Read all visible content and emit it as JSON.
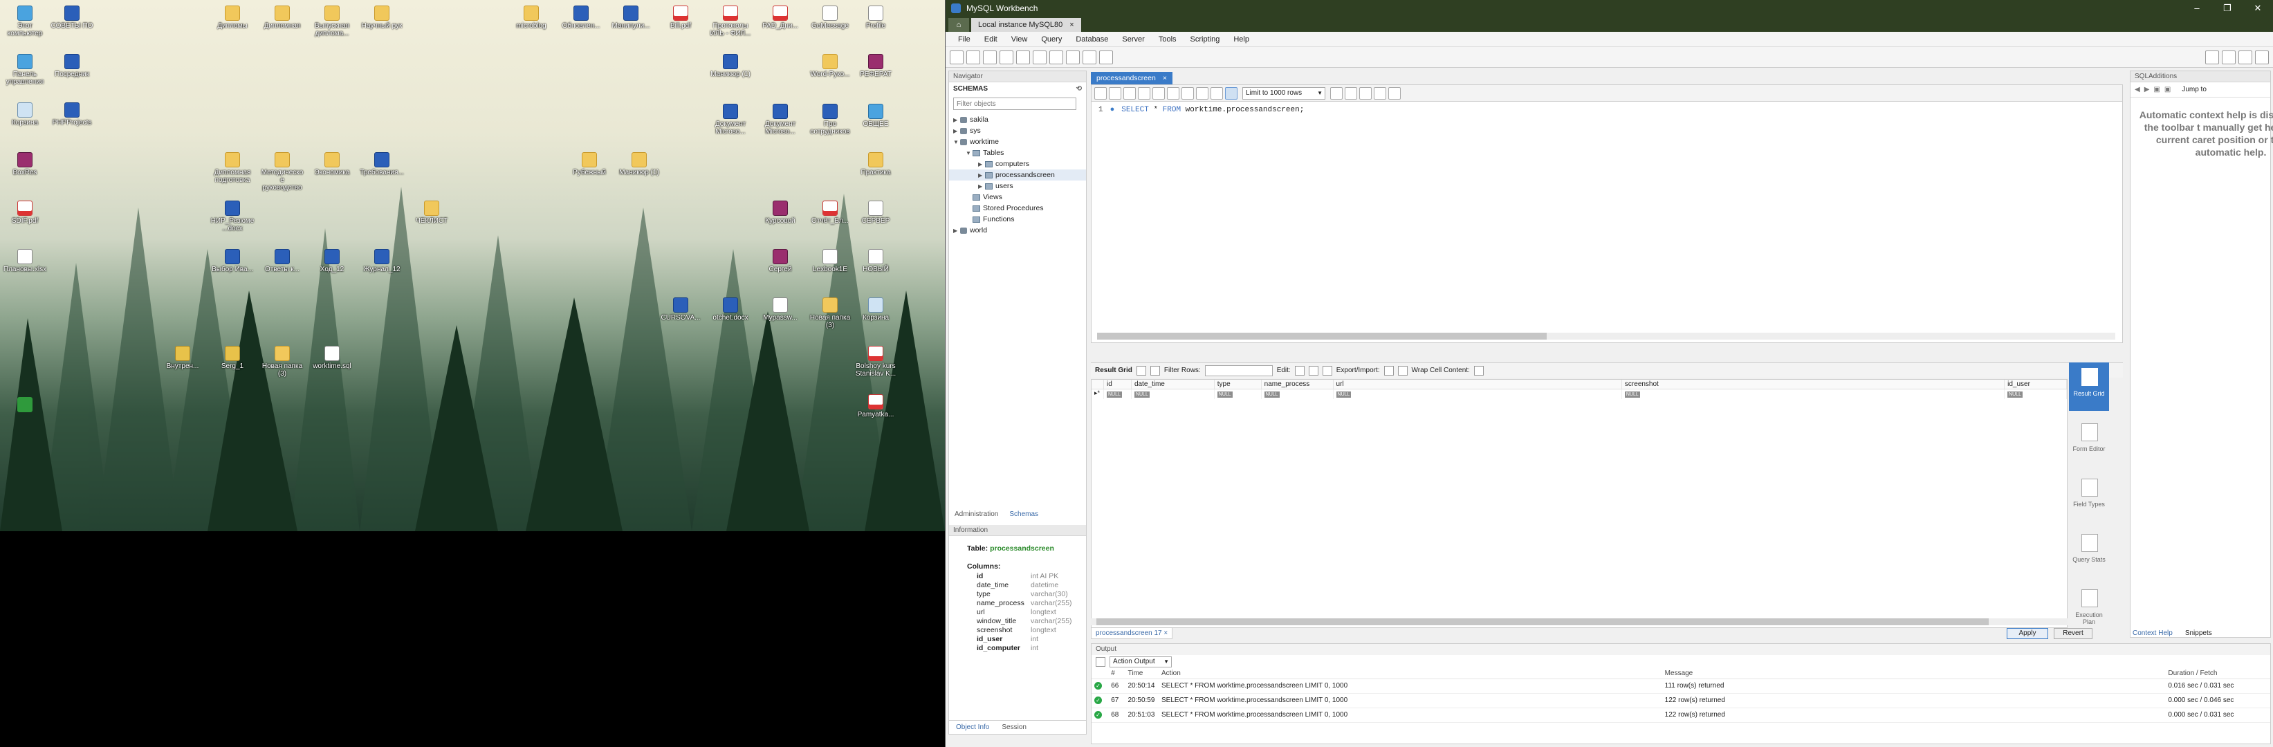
{
  "desktop": {
    "icons": [
      {
        "label": "Этот компьютер",
        "kind": "ic-pc"
      },
      {
        "label": "СОВЕТЫ ПО",
        "kind": "ic-word"
      },
      {
        "label": "Дипломы",
        "kind": "ic-folder"
      },
      {
        "label": "Дипломная",
        "kind": "ic-folder"
      },
      {
        "label": "Выпускная диплома...",
        "kind": "ic-folder"
      },
      {
        "label": "Научный рук",
        "kind": "ic-folder"
      },
      {
        "label": "microblog",
        "kind": "ic-folder"
      },
      {
        "label": "Обновлен...",
        "kind": "ic-word"
      },
      {
        "label": "Манипули...",
        "kind": "ic-word"
      },
      {
        "label": "Bill.pdf",
        "kind": "ic-pdf"
      },
      {
        "label": "Протоколы ИЛЬ - ФИЛ...",
        "kind": "ic-pdf"
      },
      {
        "label": "PAD_Дни...",
        "kind": "ic-pdf"
      },
      {
        "label": "GoMessage",
        "kind": "ic-txt"
      },
      {
        "label": "Profile",
        "kind": "ic-txt"
      },
      {
        "label": "Панель управления",
        "kind": "ic-pc"
      },
      {
        "label": "Посредник",
        "kind": "ic-word"
      },
      {
        "label": "Маникюр (1)",
        "kind": "ic-word"
      },
      {
        "label": "Word-Руко...",
        "kind": "ic-folder"
      },
      {
        "label": "РЕФЕРАТ",
        "kind": "ic-winrar"
      },
      {
        "label": "Корзина",
        "kind": "ic-bin"
      },
      {
        "label": "PHPProjects",
        "kind": "ic-word"
      },
      {
        "label": "Документ Microso...",
        "kind": "ic-word"
      },
      {
        "label": "Документ Microso...",
        "kind": "ic-word"
      },
      {
        "label": "Про сотрудников",
        "kind": "ic-word"
      },
      {
        "label": "ОБЩЕЕ",
        "kind": "ic-pc"
      },
      {
        "label": "BoxRes",
        "kind": "ic-winrar"
      },
      {
        "label": "Дипломная подготовка",
        "kind": "ic-folder"
      },
      {
        "label": "Методическое руководство",
        "kind": "ic-folder"
      },
      {
        "label": "Экономика",
        "kind": "ic-folder"
      },
      {
        "label": "Требования...",
        "kind": "ic-word"
      },
      {
        "label": "Рубежный",
        "kind": "ic-folder"
      },
      {
        "label": "Маникюр (1)",
        "kind": "ic-folder"
      },
      {
        "label": "Практика",
        "kind": "ic-folder"
      },
      {
        "label": "SDIF.pdf",
        "kind": "ic-pdf"
      },
      {
        "label": "НИР_Резюме...docx",
        "kind": "ic-word"
      },
      {
        "label": "ЧЕКЛИСТ",
        "kind": "ic-folder"
      },
      {
        "label": "Курсовой",
        "kind": "ic-winrar"
      },
      {
        "label": "Отчёт_Бл...",
        "kind": "ic-pdf"
      },
      {
        "label": "СЕРВЕР",
        "kind": "ic-txt"
      },
      {
        "label": "Плановы.xlsx",
        "kind": "ic-txt"
      },
      {
        "label": "Выбор Ива...",
        "kind": "ic-word"
      },
      {
        "label": "Ответы к...",
        "kind": "ic-word"
      },
      {
        "label": "Ход_12",
        "kind": "ic-word"
      },
      {
        "label": "Журнал_12",
        "kind": "ic-word"
      },
      {
        "label": "Сергей",
        "kind": "ic-winrar"
      },
      {
        "label": "Lexbook1E",
        "kind": "ic-txt"
      },
      {
        "label": "НОВЫЙ",
        "kind": "ic-txt"
      },
      {
        "label": "CURSOVA...",
        "kind": "ic-word"
      },
      {
        "label": "otchet.docx",
        "kind": "ic-word"
      },
      {
        "label": "Mypassw...",
        "kind": "ic-txt"
      },
      {
        "label": "Новая папка (3)",
        "kind": "ic-folder"
      },
      {
        "label": "Корзина",
        "kind": "ic-bin"
      },
      {
        "label": "Внутрен...",
        "kind": "ic-zip"
      },
      {
        "label": "Serg_1",
        "kind": "ic-zip"
      },
      {
        "label": "Новая папка (3)",
        "kind": "ic-folder"
      },
      {
        "label": "worktime.sql",
        "kind": "ic-txt"
      },
      {
        "label": "Bolshoy kurs Stanislav K...",
        "kind": "ic-pdf"
      },
      {
        "label": "Pamyatka...",
        "kind": "ic-pdf"
      },
      {
        "label": "",
        "kind": "ic-green"
      }
    ]
  },
  "window": {
    "title": "MySQL Workbench",
    "controls": [
      "–",
      "❐",
      "✕"
    ],
    "connection_tab": "Local instance MySQL80",
    "connection_close": "×"
  },
  "menu": [
    "File",
    "Edit",
    "View",
    "Query",
    "Database",
    "Server",
    "Tools",
    "Scripting",
    "Help"
  ],
  "navigator": {
    "header": "Navigator",
    "schemas_label": "SCHEMAS",
    "schemas_toggle": "⟲",
    "filter_placeholder": "Filter objects",
    "tree": [
      {
        "label": "sakila",
        "level": 0,
        "arrow": "▶",
        "icon": "db"
      },
      {
        "label": "sys",
        "level": 0,
        "arrow": "▶",
        "icon": "db"
      },
      {
        "label": "worktime",
        "level": 0,
        "arrow": "▼",
        "icon": "db"
      },
      {
        "label": "Tables",
        "level": 1,
        "arrow": "▼",
        "icon": "tbl"
      },
      {
        "label": "computers",
        "level": 2,
        "arrow": "▶",
        "icon": "tbl"
      },
      {
        "label": "processandscreen",
        "level": 2,
        "arrow": "▶",
        "icon": "tbl",
        "selected": true
      },
      {
        "label": "users",
        "level": 2,
        "arrow": "▶",
        "icon": "tbl"
      },
      {
        "label": "Views",
        "level": 1,
        "arrow": "",
        "icon": "tbl"
      },
      {
        "label": "Stored Procedures",
        "level": 1,
        "arrow": "",
        "icon": "tbl"
      },
      {
        "label": "Functions",
        "level": 1,
        "arrow": "",
        "icon": "tbl"
      },
      {
        "label": "world",
        "level": 0,
        "arrow": "▶",
        "icon": "db"
      }
    ],
    "tabs": [
      "Administration",
      "Schemas"
    ],
    "active_tab": "Schemas",
    "info_header": "Information",
    "info_table_label": "Table:",
    "info_table_name": "processandscreen",
    "columns_label": "Columns:",
    "columns": [
      {
        "name": "id",
        "type": "int AI PK",
        "bold": true
      },
      {
        "name": "date_time",
        "type": "datetime",
        "bold": false
      },
      {
        "name": "type",
        "type": "varchar(30)",
        "bold": false
      },
      {
        "name": "name_process",
        "type": "varchar(255)",
        "bold": false
      },
      {
        "name": "url",
        "type": "longtext",
        "bold": false
      },
      {
        "name": "window_title",
        "type": "varchar(255)",
        "bold": false
      },
      {
        "name": "screenshot",
        "type": "longtext",
        "bold": false
      },
      {
        "name": "id_user",
        "type": "int",
        "bold": true
      },
      {
        "name": "id_computer",
        "type": "int",
        "bold": true
      }
    ],
    "bottom_tabs": [
      "Object Info",
      "Session"
    ],
    "bottom_active": "Object Info"
  },
  "editor": {
    "tab_label": "processandscreen",
    "tab_close": "×",
    "limit_label": "Limit to 1000 rows",
    "line_number": "1",
    "sql_select": "SELECT",
    "sql_star": "*",
    "sql_from": "FROM",
    "sql_rest": "worktime.processandscreen;"
  },
  "results": {
    "result_grid_label": "Result Grid",
    "filter_rows_label": "Filter Rows:",
    "edit_label": "Edit:",
    "export_label": "Export/Import:",
    "wrap_label": "Wrap Cell Content:",
    "columns": [
      "id",
      "date_time",
      "type",
      "name_process",
      "url",
      "screenshot",
      "id_user"
    ],
    "row_marker": "▸*",
    "null_text": "NULL",
    "side_buttons": [
      "Result Grid",
      "Form Editor",
      "Field Types",
      "Query Stats",
      "Execution Plan"
    ],
    "result_tab": "processandscreen 17",
    "result_tab_close": "×",
    "apply": "Apply",
    "revert": "Revert"
  },
  "sql_additions": {
    "header": "SQLAdditions",
    "jump_label": "Jump to",
    "help": "Automatic context help is disabled. Use the toolbar t manually get help for the current caret position or t toggle automatic help.",
    "tabs": [
      "Context Help",
      "Snippets"
    ],
    "active_tab": "Context Help"
  },
  "output": {
    "header": "Output",
    "selector": "Action Output",
    "columns": [
      "",
      "#",
      "Time",
      "Action",
      "Message",
      "Duration / Fetch"
    ],
    "rows": [
      {
        "num": "66",
        "time": "20:50:14",
        "action": "SELECT * FROM worktime.processandscreen LIMIT 0, 1000",
        "message": "111 row(s) returned",
        "duration": "0.016 sec / 0.031 sec"
      },
      {
        "num": "67",
        "time": "20:50:59",
        "action": "SELECT * FROM worktime.processandscreen LIMIT 0, 1000",
        "message": "122 row(s) returned",
        "duration": "0.000 sec / 0.046 sec"
      },
      {
        "num": "68",
        "time": "20:51:03",
        "action": "SELECT * FROM worktime.processandscreen LIMIT 0, 1000",
        "message": "122 row(s) returned",
        "duration": "0.000 sec / 0.031 sec"
      }
    ],
    "ok_glyph": "✓"
  }
}
